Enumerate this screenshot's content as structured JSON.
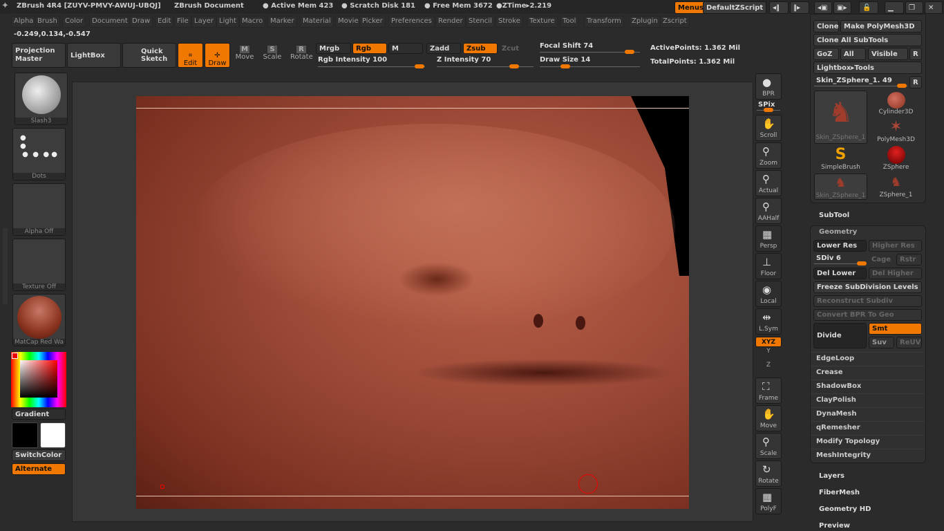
{
  "titlebar": {
    "app": "ZBrush 4R4 [ZUYV-PMVY-AWUJ-UBQJ]",
    "document": "ZBrush Document",
    "active_mem": "● Active Mem 423",
    "scratch": "● Scratch Disk 181",
    "free_mem": "● Free Mem 3672",
    "ztime": "●ZTime▸2.219",
    "menus": "Menus",
    "script": "DefaultZScript"
  },
  "menubar": [
    "Alpha",
    "Brush",
    "Color",
    "Document",
    "Draw",
    "Edit",
    "File",
    "Layer",
    "Light",
    "Macro",
    "Marker",
    "Material",
    "Movie",
    "Picker",
    "Preferences",
    "Render",
    "Stencil",
    "Stroke",
    "Texture",
    "Tool",
    "Transform",
    "Zplugin",
    "Zscript"
  ],
  "coords": "-0.249,0.134,-0.547",
  "toolbar": {
    "projection_master": "Projection Master",
    "lightbox": "LightBox",
    "quick_sketch": "Quick Sketch",
    "edit": "Edit",
    "draw": "Draw",
    "move": "Move",
    "scale": "Scale",
    "rotate": "Rotate",
    "mrgb": "Mrgb",
    "rgb": "Rgb",
    "m": "M",
    "zadd": "Zadd",
    "zsub": "Zsub",
    "zcut": "Zcut",
    "rgb_intensity": "Rgb Intensity 100",
    "z_intensity": "Z Intensity 70",
    "focal_shift": "Focal Shift 74",
    "draw_size": "Draw Size 14",
    "active_points": "ActivePoints: 1.362 Mil",
    "total_points": "TotalPoints: 1.362 Mil",
    "rgb_intensity_value": 100,
    "z_intensity_value": 70,
    "focal_shift_value": 74,
    "draw_size_value": 14
  },
  "left": {
    "brush": "Slash3",
    "stroke": "Dots",
    "alpha": "Alpha Off",
    "texture": "Texture Off",
    "material": "MatCap Red Wa",
    "gradient": "Gradient",
    "switch_color": "SwitchColor",
    "alternate": "Alternate",
    "main_color": "#000000",
    "secondary_color": "#ffffff"
  },
  "right_tray": [
    "BPR",
    "SPix",
    "Scroll",
    "Zoom",
    "Actual",
    "AAHalf",
    "Persp",
    "Floor",
    "Local",
    "L.Sym",
    "XYZ",
    "Y",
    "Z",
    "Frame",
    "Move",
    "Scale",
    "Rotate",
    "PolyF"
  ],
  "tool_panel": {
    "clone": "Clone",
    "make_polymesh": "Make PolyMesh3D",
    "clone_all": "Clone All SubTools",
    "goz": "GoZ",
    "all": "All",
    "visible": "Visible",
    "r": "R",
    "lightbox_tools": "Lightbox▸Tools",
    "current_tool": "Skin_ZSphere_1. 49",
    "tools": [
      "Skin_ZSphere_1",
      "Cylinder3D",
      "PolyMesh3D",
      "SimpleBrush",
      "ZSphere",
      "Skin_ZSphere_1",
      "ZSphere_1"
    ]
  },
  "subtool": "SubTool",
  "geometry": {
    "title": "Geometry",
    "lower_res": "Lower Res",
    "higher_res": "Higher Res",
    "sdiv": "SDiv 6",
    "cage": "Cage",
    "rstr": "Rstr",
    "del_lower": "Del Lower",
    "del_higher": "Del Higher",
    "freeze": "Freeze SubDivision Levels",
    "reconstruct": "Reconstruct Subdiv",
    "convert_bpr": "Convert BPR To Geo",
    "divide": "Divide",
    "smt": "Smt",
    "suv": "Suv",
    "reuv": "ReUV",
    "items": [
      "EdgeLoop",
      "Crease",
      "ShadowBox",
      "ClayPolish",
      "DynaMesh",
      "qRemesher",
      "Modify Topology",
      "MeshIntegrity"
    ]
  },
  "sections": [
    "Layers",
    "FiberMesh",
    "Geometry HD",
    "Preview"
  ],
  "colors": {
    "accent": "#f07800",
    "background": "#2b2b2b",
    "model": "#9a4836"
  }
}
